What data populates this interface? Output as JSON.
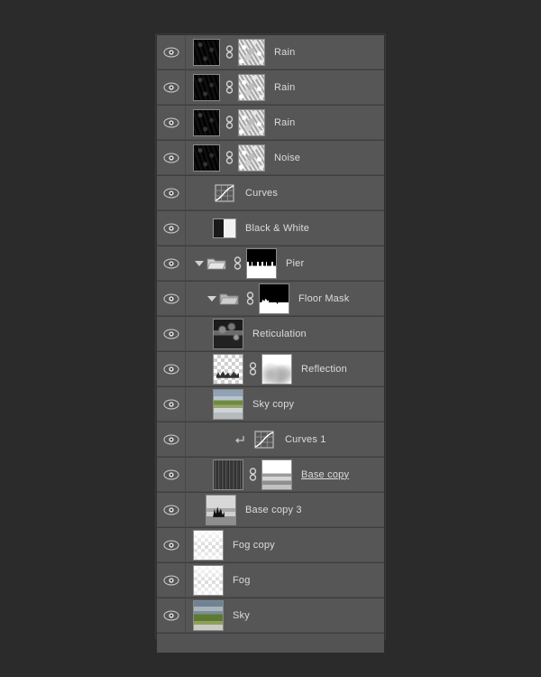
{
  "panel": {
    "name": "layers-panel",
    "background_color": "#2b2b2b",
    "row_color": "#565656",
    "text_color": "#dcdcdc"
  },
  "layers": [
    {
      "name": "Rain",
      "visible": true,
      "kind": "pixel",
      "indent": 0,
      "thumb": "dark-rain-1",
      "mask": "noise-mask",
      "linked": true,
      "underline": false
    },
    {
      "name": "Rain",
      "visible": true,
      "kind": "pixel",
      "indent": 0,
      "thumb": "dark-rain-2",
      "mask": "noise-mask",
      "linked": true,
      "underline": false
    },
    {
      "name": "Rain",
      "visible": true,
      "kind": "pixel",
      "indent": 0,
      "thumb": "dark-rain-3",
      "mask": "noise-mask",
      "linked": true,
      "underline": false
    },
    {
      "name": "Noise",
      "visible": true,
      "kind": "pixel",
      "indent": 0,
      "thumb": "dark-noise",
      "mask": "noise-mask",
      "linked": true,
      "underline": false
    },
    {
      "name": "Curves",
      "visible": true,
      "kind": "adjustment-curves",
      "indent": 0,
      "thumb": null,
      "mask": null,
      "linked": false,
      "underline": false
    },
    {
      "name": "Black & White",
      "visible": true,
      "kind": "adjustment-blackwhite",
      "indent": 0,
      "thumb": null,
      "mask": null,
      "linked": false,
      "underline": false
    },
    {
      "name": "Pier",
      "visible": true,
      "kind": "group",
      "indent": 0,
      "thumb": null,
      "mask": "pier-mask",
      "linked": true,
      "expanded": true,
      "underline": false
    },
    {
      "name": "Floor Mask",
      "visible": true,
      "kind": "group",
      "indent": 1,
      "thumb": null,
      "mask": "floor-mask",
      "linked": true,
      "expanded": true,
      "underline": false
    },
    {
      "name": "Reticulation",
      "visible": true,
      "kind": "pixel",
      "indent": 1,
      "thumb": "reticulation",
      "mask": null,
      "linked": false,
      "underline": false
    },
    {
      "name": "Reflection",
      "visible": true,
      "kind": "pixel",
      "indent": 1,
      "thumb": "reflection",
      "mask": "soft-white-mask",
      "linked": true,
      "underline": false
    },
    {
      "name": "Sky copy",
      "visible": true,
      "kind": "pixel",
      "indent": 1,
      "thumb": "sky-copy",
      "mask": null,
      "linked": false,
      "underline": false
    },
    {
      "name": "Curves 1",
      "visible": true,
      "kind": "adjustment-curves",
      "indent": 1,
      "thumb": null,
      "mask": null,
      "linked": false,
      "clipped": true,
      "underline": false
    },
    {
      "name": "Base copy",
      "visible": true,
      "kind": "pixel",
      "indent": 1,
      "thumb": "base-copy",
      "mask": "base-horizon-mask",
      "linked": true,
      "underline": true
    },
    {
      "name": "Base copy 3",
      "visible": true,
      "kind": "pixel",
      "indent": 0,
      "thumb": "base-copy-3",
      "mask": null,
      "linked": false,
      "underline": false
    },
    {
      "name": "Fog copy",
      "visible": true,
      "kind": "pixel",
      "indent": 0,
      "thumb": "fog",
      "mask": null,
      "linked": false,
      "underline": false
    },
    {
      "name": "Fog",
      "visible": true,
      "kind": "pixel",
      "indent": 0,
      "thumb": "fog",
      "mask": null,
      "linked": false,
      "underline": false
    },
    {
      "name": "Sky",
      "visible": true,
      "kind": "pixel",
      "indent": 0,
      "thumb": "sky",
      "mask": null,
      "linked": false,
      "underline": false
    }
  ],
  "icons": {
    "visibility": "eye-icon",
    "link": "link-icon",
    "disclosure": "triangle-down-icon",
    "folder": "folder-icon",
    "clipping": "clipping-mask-arrow-icon",
    "curves": "curves-adjustment-icon",
    "black_white": "black-and-white-adjustment-icon"
  }
}
